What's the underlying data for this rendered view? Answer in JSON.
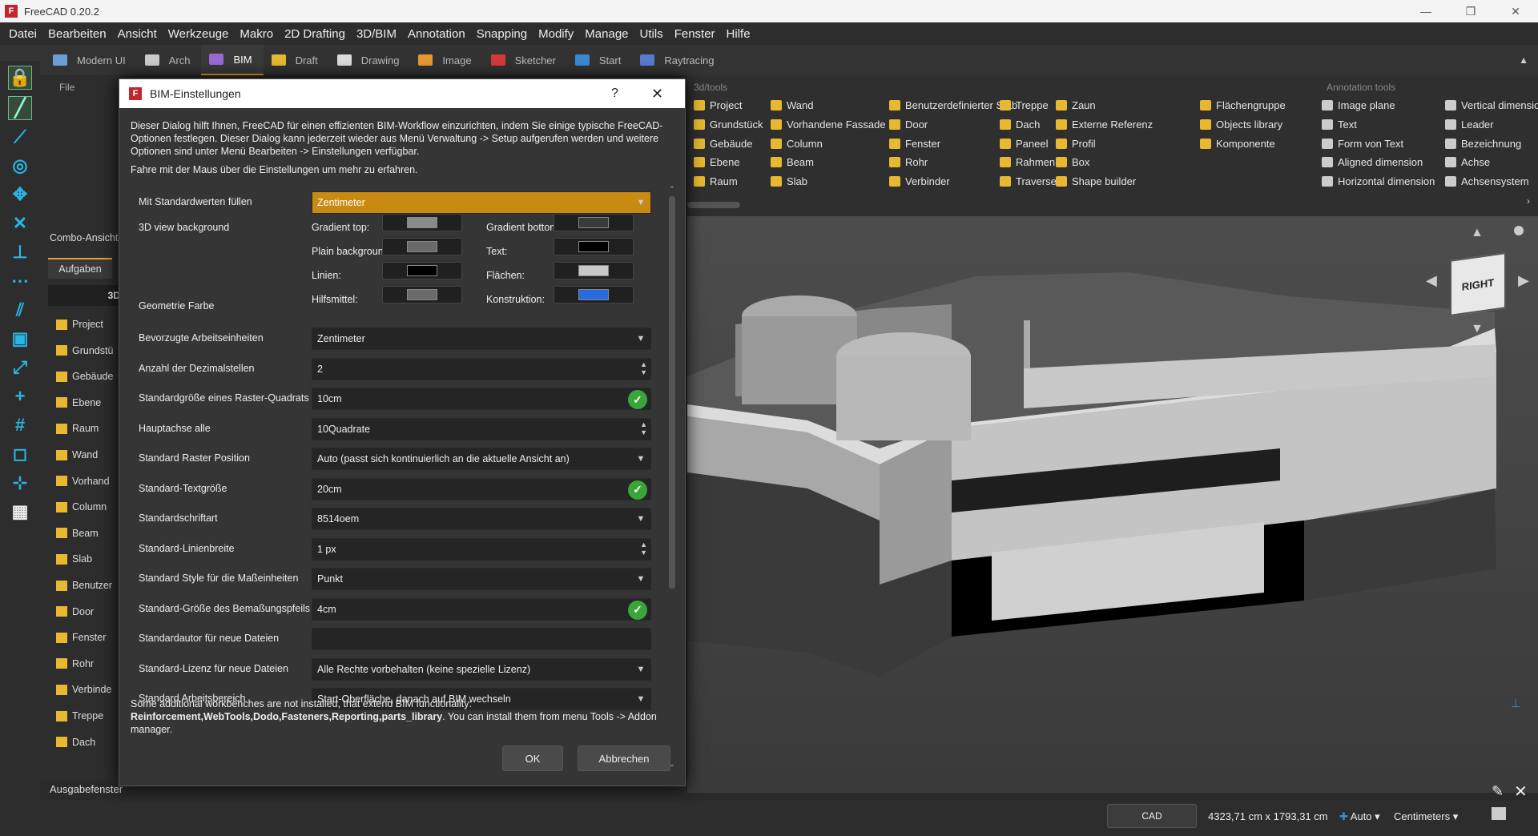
{
  "window": {
    "title": "FreeCAD 0.20.2"
  },
  "menu": [
    "Datei",
    "Bearbeiten",
    "Ansicht",
    "Werkzeuge",
    "Makro",
    "2D Drafting",
    "3D/BIM",
    "Annotation",
    "Snapping",
    "Modify",
    "Manage",
    "Utils",
    "Fenster",
    "Hilfe"
  ],
  "workbenches": [
    {
      "label": "Modern UI",
      "color": "#6a9fd4",
      "active": false
    },
    {
      "label": "Arch",
      "color": "#cccccc",
      "active": false
    },
    {
      "label": "BIM",
      "color": "#9a6ad4",
      "active": true
    },
    {
      "label": "Draft",
      "color": "#e8b830",
      "active": false
    },
    {
      "label": "Drawing",
      "color": "#dddddd",
      "active": false
    },
    {
      "label": "Image",
      "color": "#e89a30",
      "active": false
    },
    {
      "label": "Sketcher",
      "color": "#d43a3a",
      "active": false
    },
    {
      "label": "Start",
      "color": "#3a8ad4",
      "active": false
    },
    {
      "label": "Raytracing",
      "color": "#5a7ad4",
      "active": false
    }
  ],
  "left_panel": {
    "file_label": "File",
    "combo_label": "Combo-Ansicht",
    "tab": "Aufgaben",
    "section": "3D",
    "items": [
      "Project",
      "Grundstü",
      "Gebäude",
      "Ebene",
      "Raum",
      "Wand",
      "Vorhand",
      "Column",
      "Beam",
      "Slab",
      "Benutzer",
      "Door",
      "Fenster",
      "Rohr",
      "Verbinde",
      "Treppe",
      "Dach"
    ]
  },
  "ribbon": {
    "group_3d": "3d/tools",
    "group_annotation": "Annotation tools",
    "col1": [
      "Project",
      "Grundstück",
      "Gebäude",
      "Ebene",
      "Raum"
    ],
    "col2": [
      "Wand",
      "Vorhandene Fassade",
      "Column",
      "Beam",
      "Slab"
    ],
    "col3": [
      "Benutzerdefinierter Stab",
      "Door",
      "Fenster",
      "Rohr",
      "Verbinder"
    ],
    "col4": [
      "Treppe",
      "Dach",
      "Paneel",
      "Rahmen",
      "Traverse"
    ],
    "col5": [
      "Zaun",
      "Externe Referenz",
      "Profil",
      "Box",
      "Shape builder"
    ],
    "col6": [
      "Flächengruppe",
      "Objects library",
      "Komponente"
    ],
    "col7": [
      "Image plane",
      "Text",
      "Form von Text",
      "Aligned dimension",
      "Horizontal dimension"
    ],
    "col8": [
      "Vertical dimensio",
      "Leader",
      "Bezeichnung",
      "Achse",
      "Achsensystem"
    ]
  },
  "navcube": {
    "face": "RIGHT"
  },
  "dialog": {
    "title": "BIM-Einstellungen",
    "help": "?",
    "close": "✕",
    "intro": "Dieser Dialog hilft Ihnen, FreeCAD für einen effizienten BIM-Workflow einzurichten, indem Sie einige typische FreeCAD-Optionen festlegen. Dieser Dialog kann jederzeit wieder aus Menü Verwaltung -> Setup aufgerufen werden und weitere Optionen sind unter Menü Bearbeiten -> Einstellungen verfügbar.",
    "hover_hint": "Fahre mit der Maus über die Einstellungen um mehr zu erfahren.",
    "fill_defaults": {
      "label": "Mit Standardwerten füllen",
      "value": "Zentimeter"
    },
    "bg_label": "3D view background",
    "geo_label": "Geometrie Farbe",
    "colors": {
      "gradient_top": {
        "label": "Gradient top:",
        "color": "#8a8a8a"
      },
      "gradient_bottom": {
        "label": "Gradient bottom:",
        "color": "#3a3a3a"
      },
      "plain_bg": {
        "label": "Plain background::",
        "color": "#6a6a6a"
      },
      "text": {
        "label": "Text:",
        "color": "#000000"
      },
      "linien": {
        "label": "Linien:",
        "color": "#000000"
      },
      "flaechen": {
        "label": "Flächen:",
        "color": "#c8c8c8"
      },
      "hilfsmittel": {
        "label": "Hilfsmittel:",
        "color": "#6a6a6a"
      },
      "konstruktion": {
        "label": "Konstruktion:",
        "color": "#2a6ae0"
      }
    },
    "settings": [
      {
        "label": "Bevorzugte Arbeitseinheiten",
        "value": "Zentimeter",
        "kind": "combo"
      },
      {
        "label": "Anzahl der Dezimalstellen",
        "value": "2",
        "kind": "spin"
      },
      {
        "label": "Standardgröße eines Raster-Quadrats",
        "value": "10cm",
        "kind": "ok"
      },
      {
        "label": "Hauptachse alle",
        "value": "10Quadrate",
        "kind": "spin"
      },
      {
        "label": "Standard Raster Position",
        "value": "Auto (passt sich kontinuierlich an die aktuelle Ansicht an)",
        "kind": "combo"
      },
      {
        "label": "Standard-Textgröße",
        "value": "20cm",
        "kind": "ok"
      },
      {
        "label": "Standardschriftart",
        "value": "8514oem",
        "kind": "combo"
      },
      {
        "label": "Standard-Linienbreite",
        "value": "1 px",
        "kind": "spin"
      },
      {
        "label": "Standard Style für die Maßeinheiten",
        "value": "Punkt",
        "kind": "combo"
      },
      {
        "label": "Standard-Größe des Bemaßungspfeils",
        "value": "4cm",
        "kind": "ok"
      },
      {
        "label": "Standardautor für neue Dateien",
        "value": "",
        "kind": "text"
      },
      {
        "label": "Standard-Lizenz für neue Dateien",
        "value": "Alle Rechte vorbehalten (keine spezielle Lizenz)",
        "kind": "combo"
      },
      {
        "label": "Standard Arbeitsbereich",
        "value": "Start-Oberfläche, danach auf BIM wechseln",
        "kind": "combo"
      }
    ],
    "note_prefix": "Some additional workbenches are not installed, that extend BIM functionality: ",
    "note_bold": "Reinforcement,WebTools,Dodo,Fasteners,Reporting,parts_library",
    "note_suffix": ". You can install them from menu Tools -> Addon manager.",
    "ok": "OK",
    "cancel": "Abbrechen"
  },
  "status": {
    "output": "Ausgabefenster",
    "cad": "CAD",
    "dimensions": "4323,71 cm x 1793,31 cm",
    "auto": "Auto",
    "unit": "Centimeters"
  }
}
